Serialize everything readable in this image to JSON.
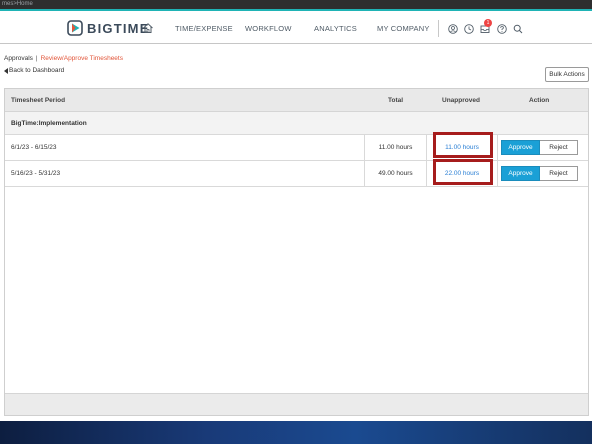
{
  "window": {
    "title_fragment": "mes>Home"
  },
  "colors": {
    "brand_teal": "#1fb3b5",
    "approve": "#1aa0d6",
    "link": "#2a7fd4",
    "breadcrumb_current": "#e2563a",
    "highlight": "#a61c1c"
  },
  "header": {
    "logo_text": "BIGTIME",
    "nav": [
      "TIME/EXPENSE",
      "WORKFLOW",
      "ANALYTICS",
      "MY COMPANY"
    ],
    "icons": [
      "home-icon",
      "user-icon",
      "clock-icon",
      "inbox-icon",
      "help-icon",
      "search-icon"
    ],
    "notification_count": "1"
  },
  "breadcrumb": {
    "root": "Approvals",
    "separator": "|",
    "current": "Review/Approve Timesheets"
  },
  "back_link": "Back to Dashboard",
  "bulk_actions": "Bulk Actions",
  "table": {
    "headers": {
      "period": "Timesheet Period",
      "total": "Total",
      "unapproved": "Unapproved",
      "action": "Action"
    },
    "group": "BigTime:Implementation",
    "rows": [
      {
        "period": "6/1/23 - 6/15/23",
        "total": "11.00 hours",
        "unapproved": "11.00 hours",
        "approve": "Approve",
        "reject": "Reject"
      },
      {
        "period": "5/16/23 - 5/31/23",
        "total": "49.00 hours",
        "unapproved": "22.00 hours",
        "approve": "Approve",
        "reject": "Reject"
      }
    ]
  }
}
